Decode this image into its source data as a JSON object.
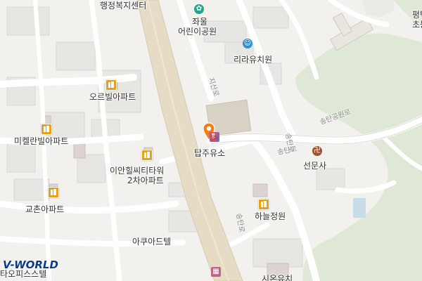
{
  "map": {
    "labels": {
      "welfare_center": "행정복지센터",
      "children_park_1": "좌울",
      "children_park_2": "어린이공원",
      "kindergarten": "리라유치원",
      "orbil_apt": "오르빌아파트",
      "mikelan_apt": "미켈란빌아파트",
      "ian_1": "이안힐씨티타워",
      "ian_2": "2차아파트",
      "gyochon_apt": "교촌아파트",
      "tapju": "탑주유소",
      "seonunsa": "선문사",
      "haneul": "하늘정원",
      "acuad": "아쿠아드텔",
      "office_partial": "타오피스스텔",
      "top_right_1": "평택",
      "top_right_2": "초등",
      "bottom_partial": "시온유치"
    },
    "roads": {
      "jigan": "지산로",
      "songtan_1": "송탄공원로",
      "songtan_2": "송탄로",
      "songtan_3": "송탄로",
      "songtan_4": "송탄로"
    },
    "logo_text": "V-WORLD",
    "colors": {
      "background": "#f2f1ee",
      "main_road": "#e6dcc6",
      "green_area": "#dfe8d6",
      "pin": "#f07d16",
      "apartment_icon": "#e3a21a"
    }
  }
}
